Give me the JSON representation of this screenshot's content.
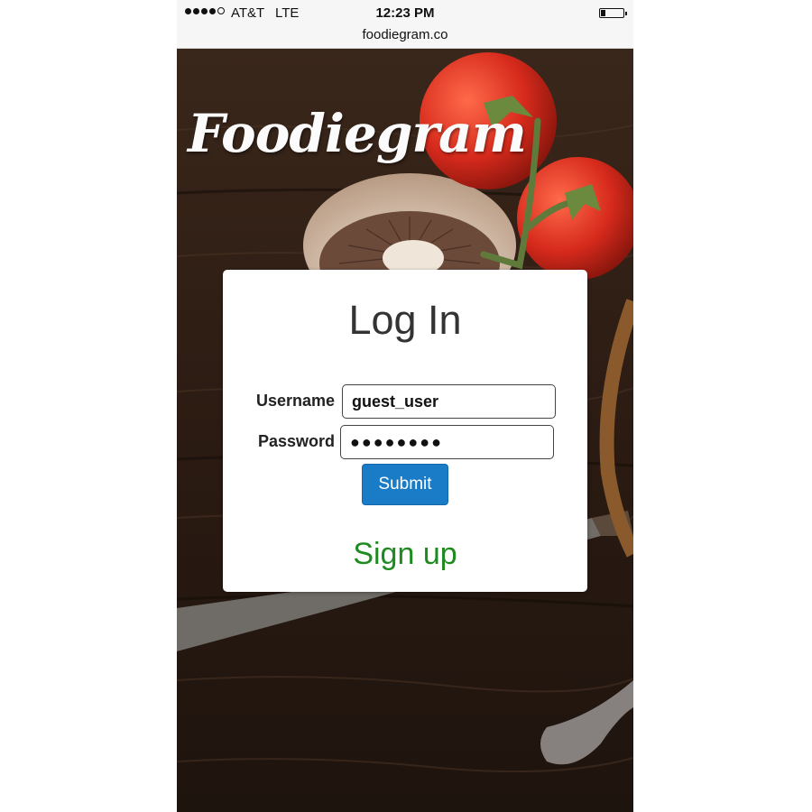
{
  "status_bar": {
    "carrier": "AT&T",
    "network": "LTE",
    "time": "12:23 PM",
    "signal_bars_filled": 4,
    "signal_bars_total": 5,
    "battery_level": 0.2
  },
  "browser": {
    "url": "foodiegram.co"
  },
  "brand": {
    "logo_text": "Foodiegram"
  },
  "login": {
    "title": "Log In",
    "username_label": "Username",
    "username_value": "guest_user",
    "password_label": "Password",
    "password_value": "●●●●●●●●",
    "submit_label": "Submit",
    "signup_label": "Sign up"
  },
  "colors": {
    "submit_button": "#1a7bc7",
    "signup_link": "#1f8a1f",
    "background_wood": "#2a1a12",
    "tomato": "#d62a1c"
  }
}
